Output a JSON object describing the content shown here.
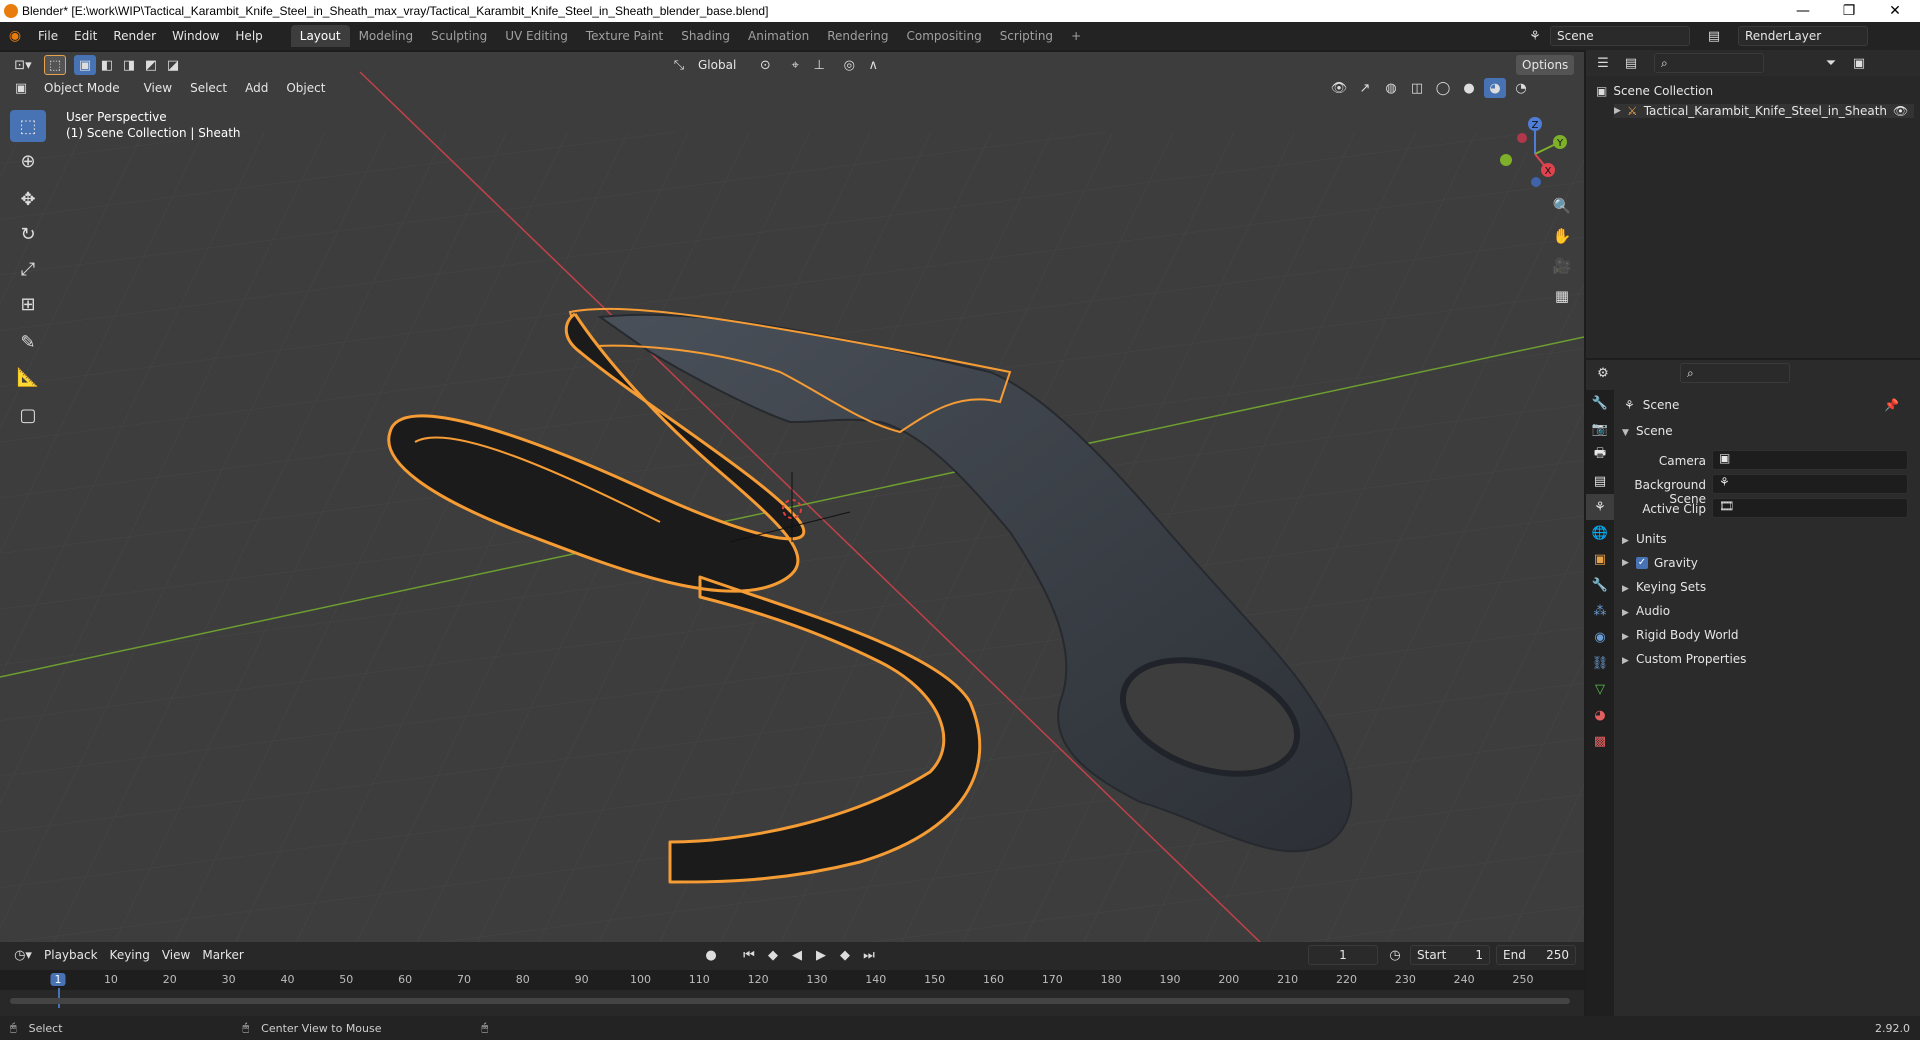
{
  "window": {
    "title": "Blender* [E:\\work\\WIP\\Tactical_Karambit_Knife_Steel_in_Sheath_max_vray/Tactical_Karambit_Knife_Steel_in_Sheath_blender_base.blend]",
    "minimize": "—",
    "maximize": "❐",
    "close": "✕"
  },
  "menu": [
    "File",
    "Edit",
    "Render",
    "Window",
    "Help"
  ],
  "workspaces": [
    "Layout",
    "Modeling",
    "Sculpting",
    "UV Editing",
    "Texture Paint",
    "Shading",
    "Animation",
    "Rendering",
    "Compositing",
    "Scripting"
  ],
  "active_workspace": "Layout",
  "add_workspace": "+",
  "scene_name": "Scene",
  "view_layer": "RenderLayer",
  "viewport": {
    "mode": "Object Mode",
    "menus": [
      "View",
      "Select",
      "Add",
      "Object"
    ],
    "orientation": "Global",
    "options_label": "Options",
    "perspective": "User Perspective",
    "context": "(1) Scene Collection | Sheath",
    "gizmo_axes": [
      "X",
      "Y",
      "Z"
    ],
    "colors": {
      "background": "#3d3d3d",
      "x_axis": "#c2414a",
      "y_axis": "#6d9e2f",
      "selection_outline": "#f59c35",
      "knife_body": "#3b4047"
    }
  },
  "outliner": {
    "root": "Scene Collection",
    "items": [
      "Tactical_Karambit_Knife_Steel_in_Sheath"
    ]
  },
  "properties": {
    "breadcrumb": "Scene",
    "section": "Scene",
    "fields": [
      {
        "label": "Camera",
        "value": ""
      },
      {
        "label": "Background Scene",
        "value": ""
      },
      {
        "label": "Active Clip",
        "value": ""
      }
    ],
    "subpanels": [
      "Units",
      "Gravity",
      "Keying Sets",
      "Audio",
      "Rigid Body World",
      "Custom Properties"
    ],
    "gravity_checked": true
  },
  "timeline": {
    "menus": [
      "Playback",
      "Keying",
      "View",
      "Marker"
    ],
    "current_frame": "1",
    "start_label": "Start",
    "start": "1",
    "end_label": "End",
    "end": "250",
    "ticks": [
      "1",
      "10",
      "20",
      "30",
      "40",
      "50",
      "60",
      "70",
      "80",
      "90",
      "100",
      "110",
      "120",
      "130",
      "140",
      "150",
      "160",
      "170",
      "180",
      "190",
      "200",
      "210",
      "220",
      "230",
      "240",
      "250"
    ]
  },
  "status": {
    "select": "Select",
    "center": "Center View to Mouse",
    "version": "2.92.0"
  }
}
